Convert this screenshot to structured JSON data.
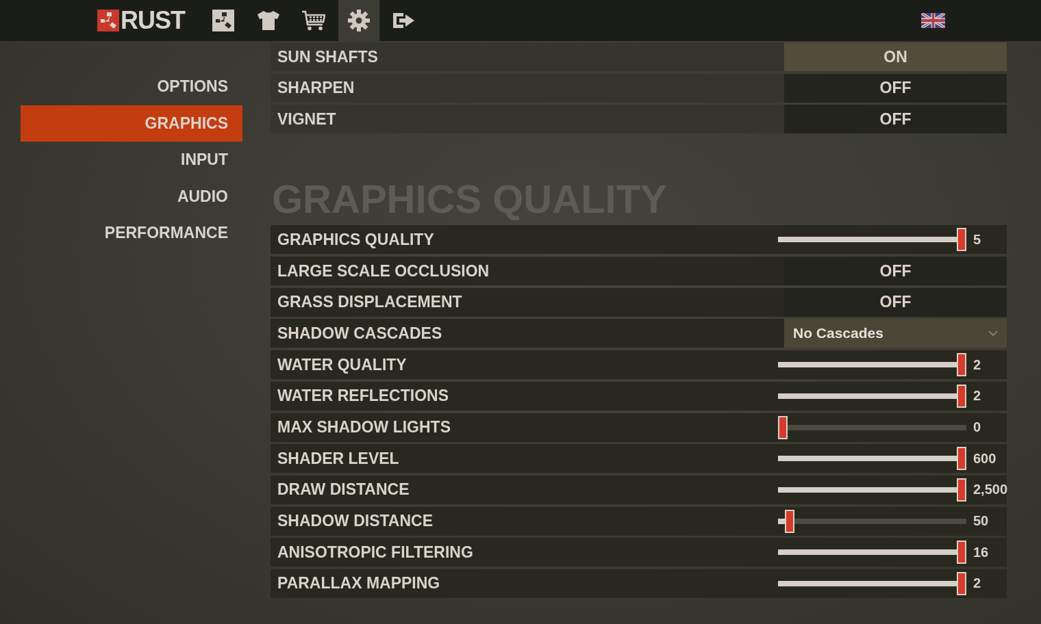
{
  "logo": {
    "text": "RUST"
  },
  "nav_tabs": [
    {
      "kind": "symbol",
      "selected": false
    },
    {
      "kind": "shirt",
      "selected": false
    },
    {
      "kind": "cart",
      "selected": false
    },
    {
      "kind": "gear",
      "selected": true
    },
    {
      "kind": "exit",
      "selected": false
    }
  ],
  "sidebar": {
    "items": [
      {
        "label": "OPTIONS",
        "selected": false
      },
      {
        "label": "GRAPHICS",
        "selected": true
      },
      {
        "label": "INPUT",
        "selected": false
      },
      {
        "label": "AUDIO",
        "selected": false
      },
      {
        "label": "PERFORMANCE",
        "selected": false
      }
    ]
  },
  "sections": [
    {
      "rows": [
        {
          "kind": "toggle",
          "label": "SUN SHAFTS",
          "value": "ON",
          "on": true
        },
        {
          "kind": "toggle",
          "label": "SHARPEN",
          "value": "OFF",
          "on": false
        },
        {
          "kind": "toggle",
          "label": "VIGNET",
          "value": "OFF",
          "on": false
        }
      ]
    },
    {
      "title": "GRAPHICS QUALITY",
      "rows": [
        {
          "kind": "slider",
          "label": "GRAPHICS QUALITY",
          "level": 1,
          "reading": "5"
        },
        {
          "kind": "toggle",
          "label": "LARGE SCALE OCCLUSION",
          "value": "OFF",
          "on": false
        },
        {
          "kind": "toggle",
          "label": "GRASS DISPLACEMENT",
          "value": "OFF",
          "on": false
        },
        {
          "kind": "dropdown",
          "label": "SHADOW CASCADES",
          "value": "No Cascades"
        },
        {
          "kind": "slider",
          "label": "WATER QUALITY",
          "level": 1,
          "reading": "2"
        },
        {
          "kind": "slider",
          "label": "WATER REFLECTIONS",
          "level": 1,
          "reading": "2"
        },
        {
          "kind": "slider",
          "label": "MAX SHADOW LIGHTS",
          "level": 0,
          "reading": "0"
        },
        {
          "kind": "slider",
          "label": "SHADER LEVEL",
          "level": 1,
          "reading": "600"
        },
        {
          "kind": "slider",
          "label": "DRAW DISTANCE",
          "level": 1,
          "reading": "2,500"
        },
        {
          "kind": "slider",
          "label": "SHADOW DISTANCE",
          "level": 0.04,
          "reading": "50"
        },
        {
          "kind": "slider",
          "label": "ANISOTROPIC FILTERING",
          "level": 1,
          "reading": "16"
        },
        {
          "kind": "slider",
          "label": "PARALLAX MAPPING",
          "level": 1,
          "reading": "2"
        }
      ]
    }
  ]
}
